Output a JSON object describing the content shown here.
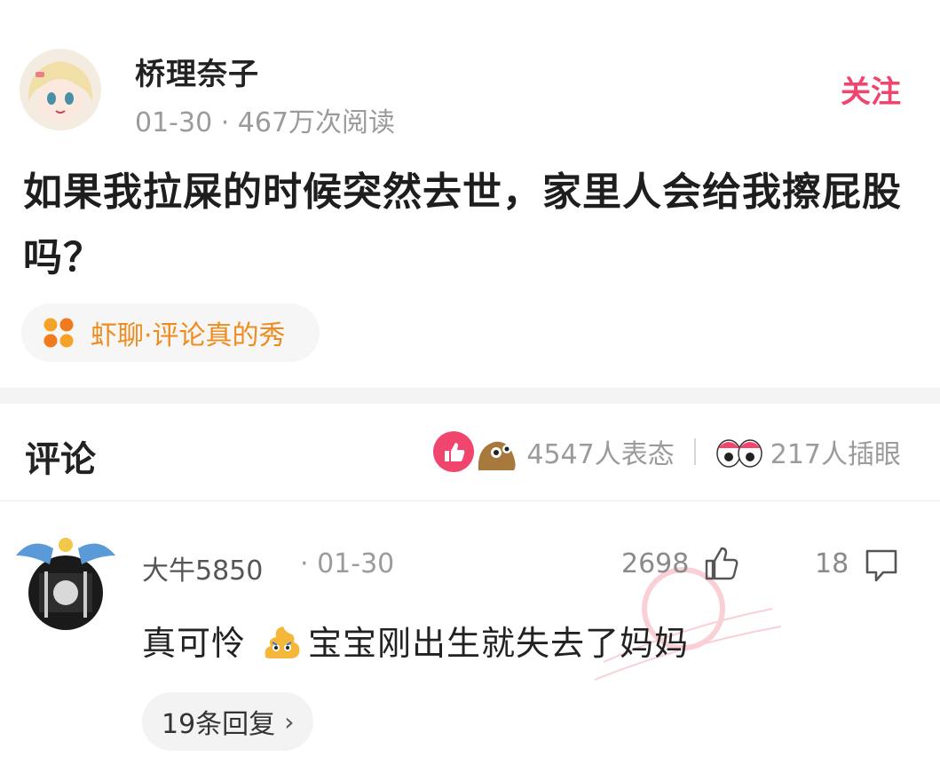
{
  "post": {
    "author": "桥理奈子",
    "meta": "01-30 · 467万次阅读",
    "follow_label": "关注",
    "title": "如果我拉屎的时候突然去世，家里人会给我擦屁股吗？",
    "tag": "虾聊·评论真的秀"
  },
  "comments_header": {
    "title": "评论",
    "reactions_label": "4547人表态",
    "peek_label": "217人插眼"
  },
  "comment": {
    "user": "大牛5850",
    "date": "· 01-30",
    "likes": "2698",
    "replies_count": "18",
    "text_before": "真可怜",
    "text_after": "宝宝刚出生就失去了妈妈",
    "replies_button": "19条回复"
  },
  "colors": {
    "accent": "#f0466e",
    "tag": "#f08c1e"
  }
}
